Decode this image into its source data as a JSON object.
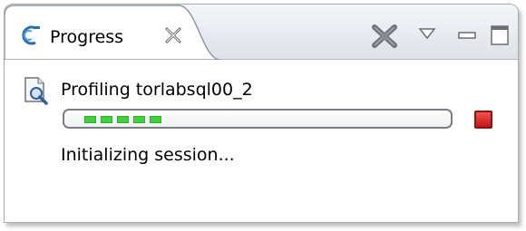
{
  "tab": {
    "title": "Progress",
    "icon": "progress-view-icon"
  },
  "toolbar": {
    "icons": [
      "remove-all-finished-icon",
      "view-menu-icon",
      "minimize-icon",
      "maximize-icon"
    ]
  },
  "job": {
    "title": "Profiling torlabsql00_2",
    "icon": "profiling-magnifier-icon",
    "progress_fraction": 0.25,
    "segments_filled": 5,
    "status": "Initializing session...",
    "stop_icon": "stop-icon"
  },
  "colors": {
    "progress_green": "#42d13c",
    "stop_red": "#d42020",
    "tab_border": "#8f97a3"
  }
}
